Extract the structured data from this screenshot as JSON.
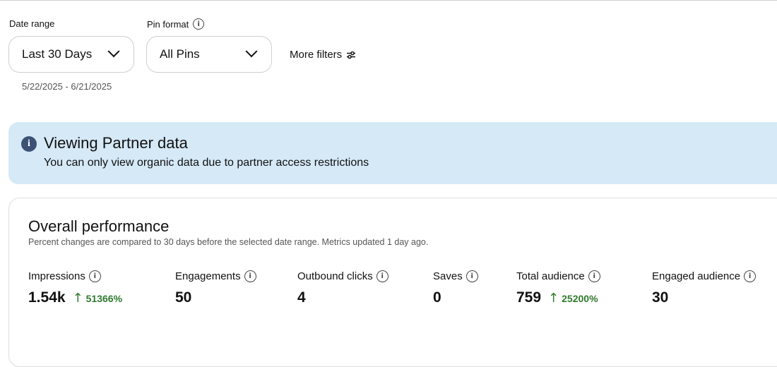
{
  "filters": {
    "date_range": {
      "label": "Date range",
      "value": "Last 30 Days",
      "sub": "5/22/2025 - 6/21/2025"
    },
    "pin_format": {
      "label": "Pin format",
      "value": "All Pins"
    },
    "more_filters": "More filters"
  },
  "banner": {
    "title": "Viewing Partner data",
    "text": "You can only view organic data due to partner access restrictions",
    "color": "#d5e9f7"
  },
  "overall": {
    "title": "Overall performance",
    "subtitle": "Percent changes are compared to 30 days before the selected date range. Metrics updated 1 day ago.",
    "metrics": [
      {
        "label": "Impressions",
        "value": "1.54k",
        "change": "51366%"
      },
      {
        "label": "Engagements",
        "value": "50"
      },
      {
        "label": "Outbound clicks",
        "value": "4"
      },
      {
        "label": "Saves",
        "value": "0"
      },
      {
        "label": "Total audience",
        "value": "759",
        "change": "25200%"
      },
      {
        "label": "Engaged audience",
        "value": "30"
      }
    ]
  },
  "colors": {
    "positive": "#2f7a2f",
    "info_icon": "#3b5275"
  }
}
